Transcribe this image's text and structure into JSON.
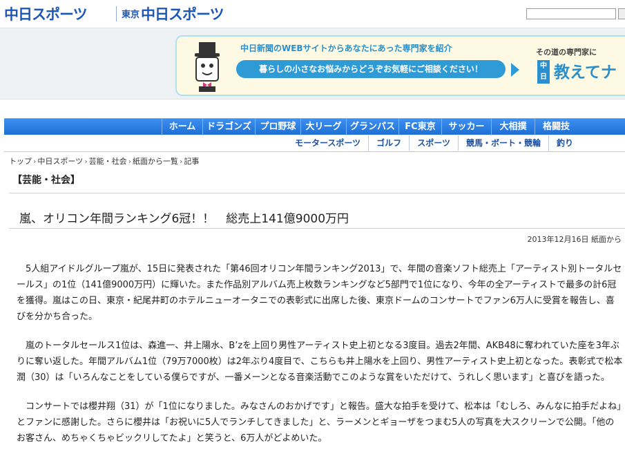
{
  "header": {
    "logo_main": "中日スポーツ",
    "logo_tokyo_small": "東京",
    "logo_tokyo_main": "中日スポーツ"
  },
  "ad": {
    "line1": "中日新聞のWEBサイトからあなたにあった専門家を紹介",
    "line2": "暮らしの小さなお悩みからどうぞお気軽にご相談ください！",
    "sub": "その道の専門家に",
    "tag": "中日",
    "brand": "教えてナ"
  },
  "nav": {
    "main_items": [
      "ホーム",
      "ドラゴンズ",
      "プロ野球",
      "大リーグ",
      "グランパス",
      "FC東京",
      "サッカー",
      "大相撲",
      "格闘技"
    ],
    "sub_items": [
      "モータースポーツ",
      "ゴルフ",
      "スポーツ",
      "競馬・ボート・競輪",
      "釣り"
    ]
  },
  "breadcrumb": [
    "トップ",
    "中日スポーツ",
    "芸能・社会",
    "紙面から一覧",
    "記事"
  ],
  "category": "【芸能・社会】",
  "article": {
    "headline": "嵐、オリコン年間ランキング6冠！！　総売上141億9000万円",
    "date": "2013年12月16日",
    "source": "紙面から",
    "paragraphs": [
      "5人組アイドルグループ嵐が、15日に発表された「第46回オリコン年間ランキング2013」で、年間の音楽ソフト総売上「アーティスト別トータルセールス」の1位（141億9000万円）に輝いた。また作品別アルバム売上枚数ランキングなど5部門で1位になり、今年の全アーティストで最多の計6冠を獲得。嵐はこの日、東京・紀尾井町のホテルニューオータニでの表彰式に出席した後、東京ドームのコンサートでファン6万人に受賞を報告し、喜びを分かち合った。",
      "嵐のトータルセールス1位は、森進一、井上陽水、B’zを上回り男性アーティスト史上初となる3度目。過去2年間、AKB48に奪われていた座を3年ぶりに奪い返した。年間アルバム1位（79万7000枚）は2年ぶり4度目で、こちらも井上陽水を上回り、男性アーティスト史上初となった。表彰式で松本潤（30）は「いろんなことをしている僕らですが、一番メーンとなる音楽活動でこのような賞をいただけて、うれしく思います」と喜びを語った。",
      "コンサートでは櫻井翔（31）が「1位になりました。みなさんのおかげです」と報告。盛大な拍手を受けて、松本は「むしろ、みんなに拍手だよね」とファンに感謝した。さらに櫻井は「お祝いに5人でランチしてきました」と、ラーメンとギョーザをつまむ5人の写真を大スクリーンで公開。「他のお客さん、めちゃくちゃビックリしてたよ」と笑うと、6万人がどよめいた。"
    ]
  }
}
